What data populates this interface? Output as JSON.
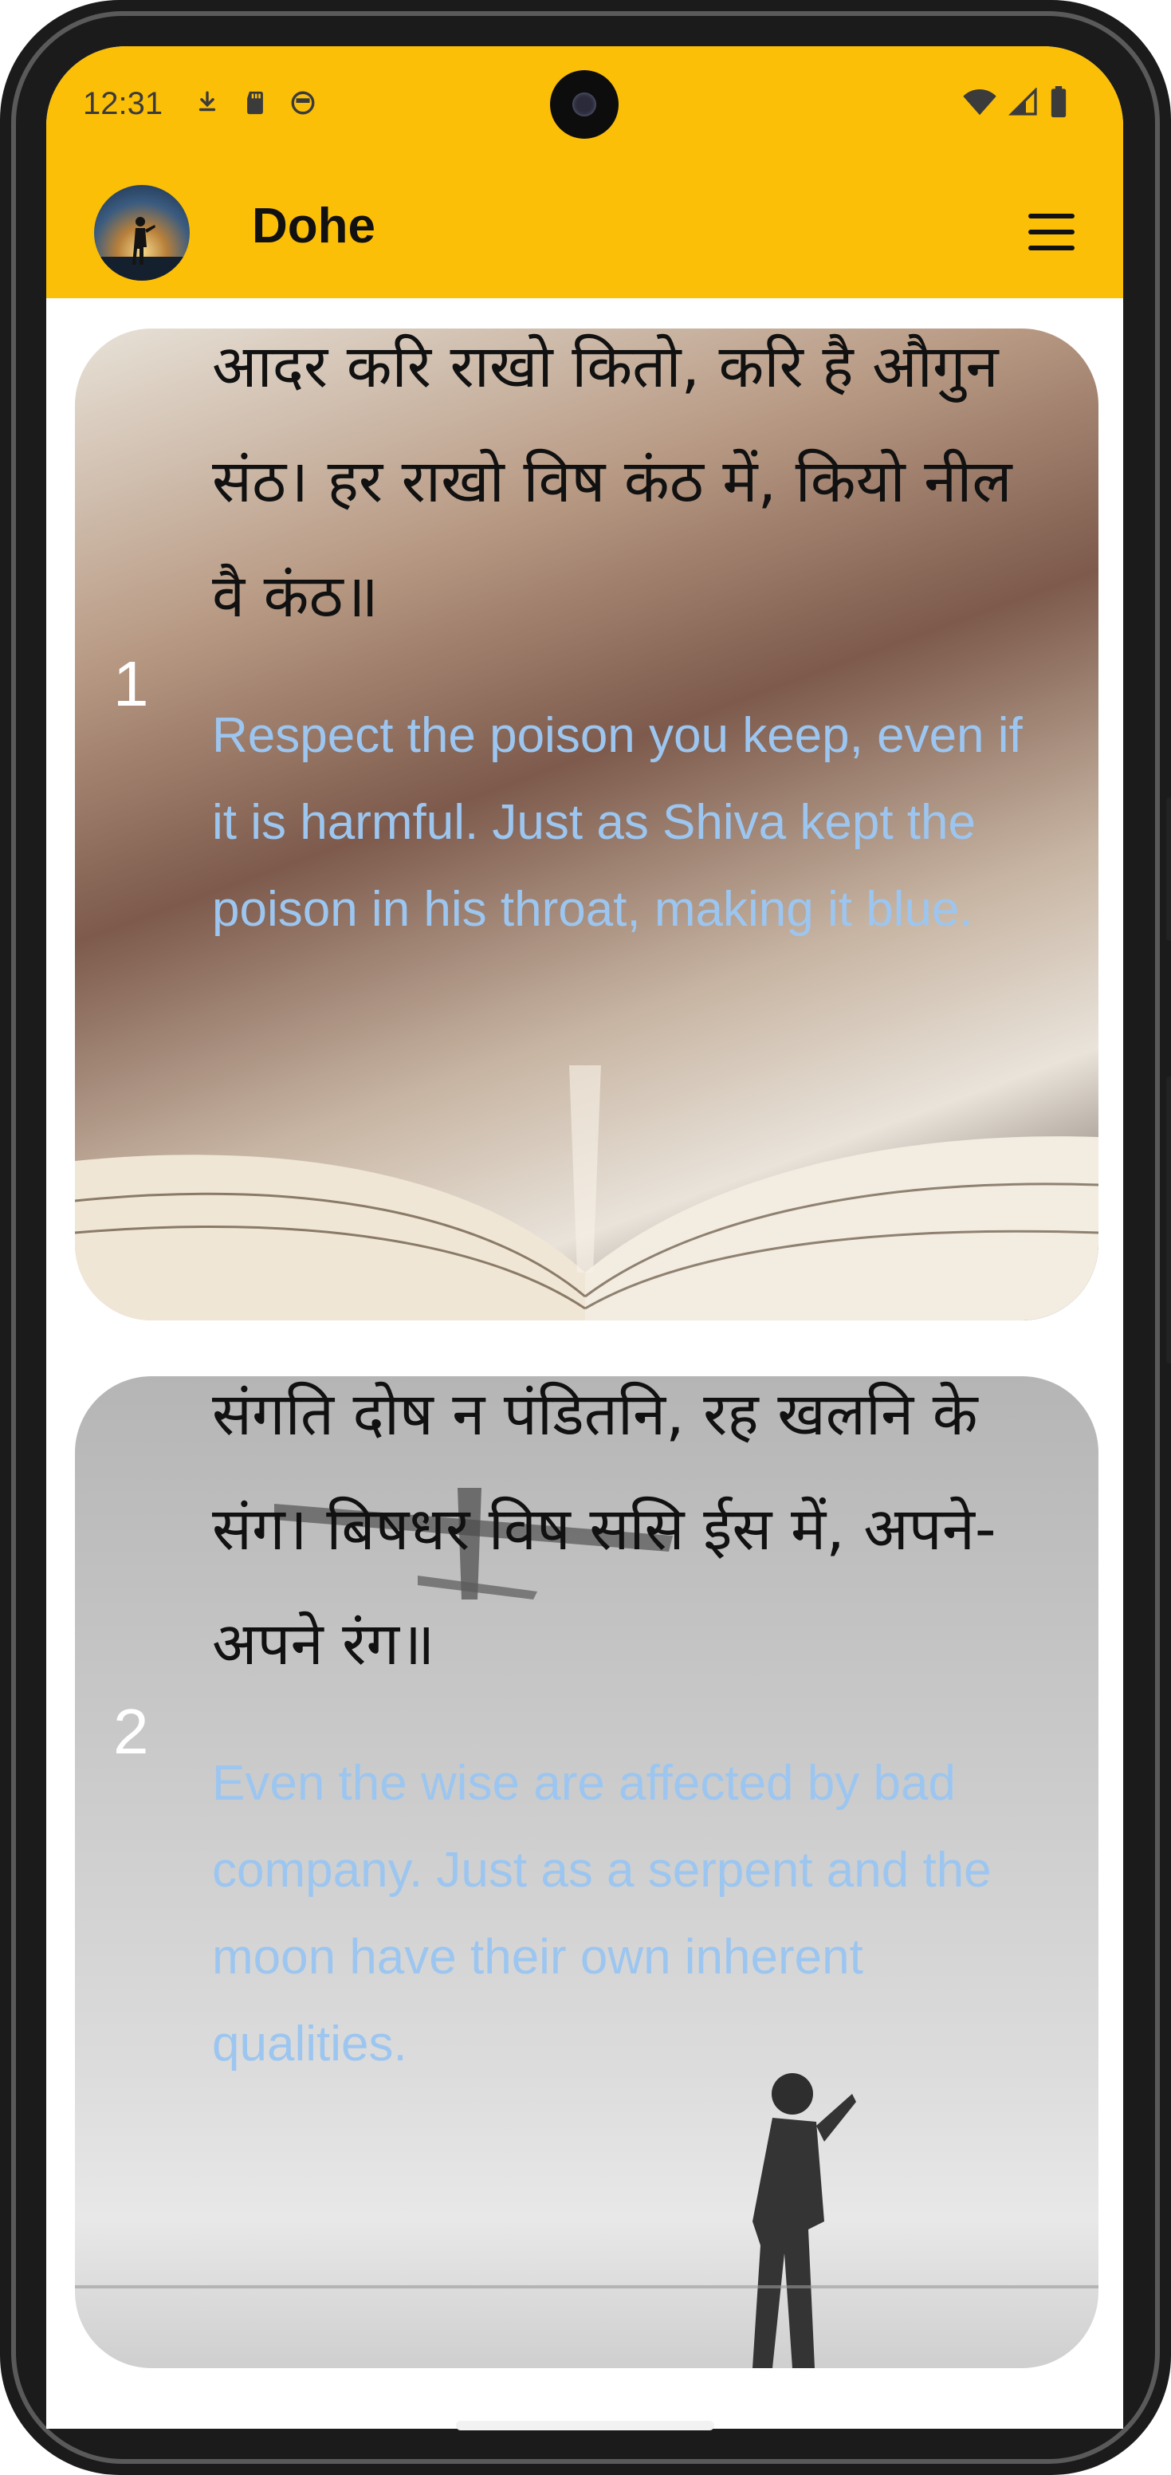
{
  "status_bar": {
    "time": "12:31",
    "left_icons": [
      "download-icon",
      "sd-card-icon",
      "app-notification-icon"
    ],
    "right_icons": [
      "wifi-icon",
      "signal-icon",
      "battery-icon"
    ]
  },
  "app_bar": {
    "title": "Dohe",
    "avatar": "avatar-image",
    "menu_icon": "hamburger-menu-icon"
  },
  "dohe": [
    {
      "number": "1",
      "hindi": "आदर करि राखो कितो, करि है औगुन संठ। हर राखो विष कंठ में, कियो नील वै कंठ॥",
      "english": "Respect the poison you keep, even if it is harmful. Just as Shiva kept the poison in his throat, making it blue."
    },
    {
      "number": "2",
      "hindi": "संगति दोष न पंडितनि, रह खलनि के संग। बिषधर विष ससि ईस में, अपने-अपने रंग॥",
      "english": "Even the wise are affected by bad company. Just as a serpent and the moon have their own inherent qualities."
    }
  ],
  "colors": {
    "app_bar": "#fcbf08",
    "english_text": "#9cc6f0",
    "number_text": "#ffffff"
  }
}
